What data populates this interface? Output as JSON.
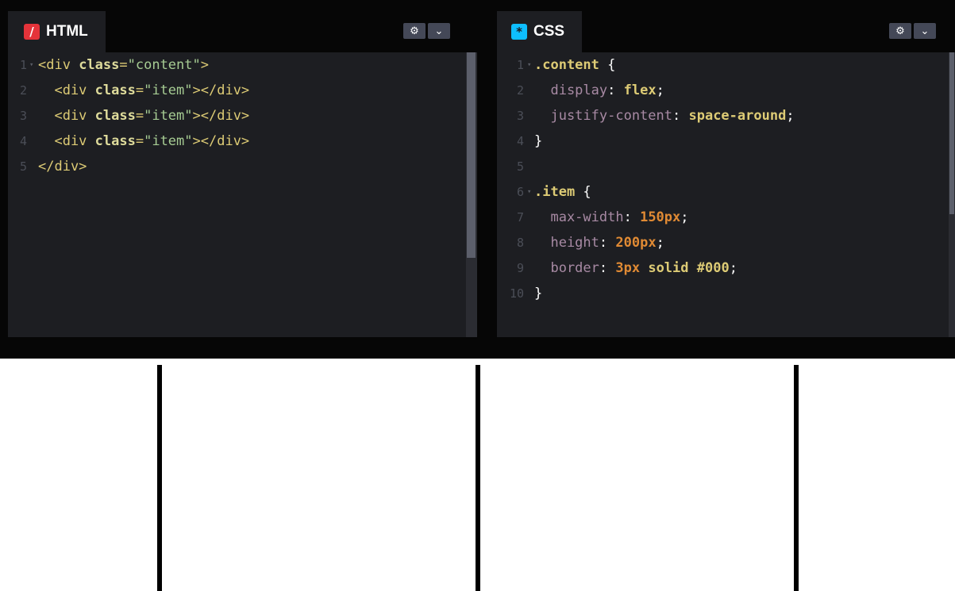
{
  "html_panel": {
    "title": "HTML",
    "badge": "/",
    "gear": "⚙",
    "chevron": "⌄",
    "lines": [
      {
        "n": "1",
        "fold": "▾",
        "parts": [
          [
            "t-tag",
            "<div "
          ],
          [
            "t-attr",
            "class"
          ],
          [
            "t-tag",
            "="
          ],
          [
            "t-str",
            "\"content\""
          ],
          [
            "t-tag",
            ">"
          ]
        ]
      },
      {
        "n": "2",
        "fold": "",
        "parts": [
          [
            "t-tag",
            "  <div "
          ],
          [
            "t-attr",
            "class"
          ],
          [
            "t-tag",
            "="
          ],
          [
            "t-str",
            "\"item\""
          ],
          [
            "t-tag",
            "></div>"
          ]
        ]
      },
      {
        "n": "3",
        "fold": "",
        "parts": [
          [
            "t-tag",
            "  <div "
          ],
          [
            "t-attr",
            "class"
          ],
          [
            "t-tag",
            "="
          ],
          [
            "t-str",
            "\"item\""
          ],
          [
            "t-tag",
            "></div>"
          ]
        ]
      },
      {
        "n": "4",
        "fold": "",
        "parts": [
          [
            "t-tag",
            "  <div "
          ],
          [
            "t-attr",
            "class"
          ],
          [
            "t-tag",
            "="
          ],
          [
            "t-str",
            "\"item\""
          ],
          [
            "t-tag",
            "></div>"
          ]
        ]
      },
      {
        "n": "5",
        "fold": "",
        "parts": [
          [
            "t-tag",
            "</div>"
          ]
        ]
      }
    ]
  },
  "css_panel": {
    "title": "CSS",
    "badge": "*",
    "gear": "⚙",
    "chevron": "⌄",
    "lines": [
      {
        "n": "1",
        "fold": "▾",
        "parts": [
          [
            "t-sel",
            ".content "
          ],
          [
            "t-punc",
            "{"
          ]
        ]
      },
      {
        "n": "2",
        "fold": "",
        "parts": [
          [
            "t-prop",
            "  display"
          ],
          [
            "t-punc",
            ": "
          ],
          [
            "t-val",
            "flex"
          ],
          [
            "t-punc",
            ";"
          ]
        ]
      },
      {
        "n": "3",
        "fold": "",
        "parts": [
          [
            "t-prop",
            "  justify-content"
          ],
          [
            "t-punc",
            ": "
          ],
          [
            "t-val",
            "space-around"
          ],
          [
            "t-punc",
            ";"
          ]
        ]
      },
      {
        "n": "4",
        "fold": "",
        "parts": [
          [
            "t-punc",
            "}"
          ]
        ]
      },
      {
        "n": "5",
        "fold": "",
        "parts": []
      },
      {
        "n": "6",
        "fold": "▾",
        "parts": [
          [
            "t-sel",
            ".item "
          ],
          [
            "t-punc",
            "{"
          ]
        ]
      },
      {
        "n": "7",
        "fold": "",
        "parts": [
          [
            "t-prop",
            "  max-width"
          ],
          [
            "t-punc",
            ": "
          ],
          [
            "t-num",
            "150px"
          ],
          [
            "t-punc",
            ";"
          ]
        ]
      },
      {
        "n": "8",
        "fold": "",
        "parts": [
          [
            "t-prop",
            "  height"
          ],
          [
            "t-punc",
            ": "
          ],
          [
            "t-num",
            "200px"
          ],
          [
            "t-punc",
            ";"
          ]
        ]
      },
      {
        "n": "9",
        "fold": "",
        "parts": [
          [
            "t-prop",
            "  border"
          ],
          [
            "t-punc",
            ": "
          ],
          [
            "t-num",
            "3px"
          ],
          [
            "t-val",
            " solid #000"
          ],
          [
            "t-punc",
            ";"
          ]
        ]
      },
      {
        "n": "10",
        "fold": "",
        "parts": [
          [
            "t-punc",
            "}"
          ]
        ]
      }
    ]
  },
  "preview": {
    "item_count": 3
  }
}
